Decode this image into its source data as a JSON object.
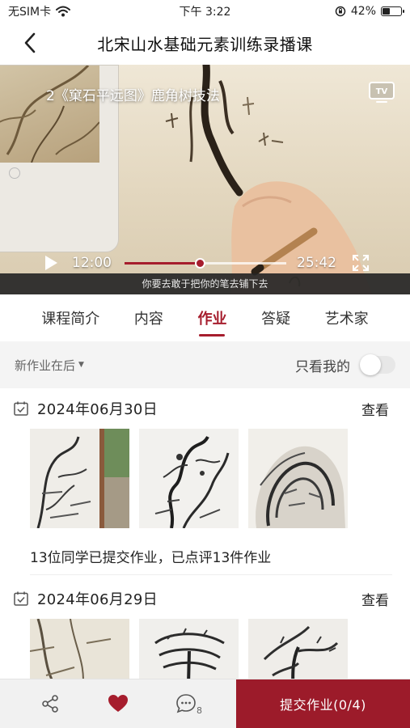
{
  "status_bar": {
    "carrier": "无SIM卡",
    "time": "下午 3:22",
    "battery_percent": "42%",
    "battery_level": 0.42
  },
  "nav": {
    "title": "北宋山水基础元素训练录播课"
  },
  "video": {
    "title": "2《窠石平远图》鹿角树技法",
    "current_time": "12:00",
    "total_time": "25:42",
    "progress": 0.467,
    "subtitle": "你要去敢于把你的笔去铺下去"
  },
  "tabs": [
    {
      "label": "课程简介"
    },
    {
      "label": "内容"
    },
    {
      "label": "作业",
      "active": true
    },
    {
      "label": "答疑"
    },
    {
      "label": "艺术家"
    }
  ],
  "filter": {
    "sort_label": "新作业在后",
    "only_mine_label": "只看我的",
    "only_mine_on": false
  },
  "homework": [
    {
      "date": "2024年06月30日",
      "view_label": "查看",
      "summary": "13位同学已提交作业，已点评13件作业"
    },
    {
      "date": "2024年06月29日",
      "view_label": "查看"
    }
  ],
  "bottom_bar": {
    "comment_count": "8",
    "submit_label": "提交作业(0/4)"
  },
  "colors": {
    "accent": "#a61d2d",
    "submit_bg": "#9c1b2a",
    "filter_bg": "#f4f4f4"
  }
}
